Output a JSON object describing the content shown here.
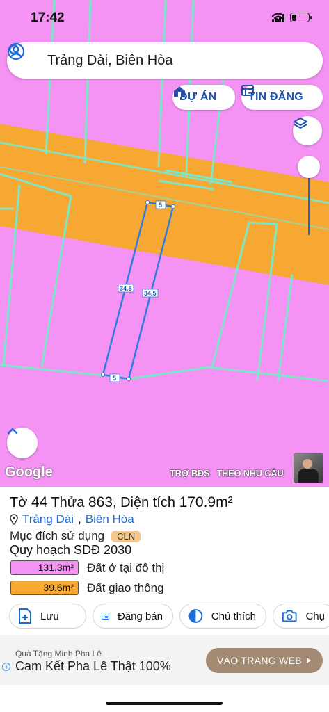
{
  "status_bar": {
    "time": "17:42"
  },
  "search": {
    "query": "Trảng Dài, Biên Hòa"
  },
  "map_buttons": {
    "project_label": "DỰ ÁN",
    "listing_label": "TIN ĐĂNG"
  },
  "map": {
    "parcel_side_top": "5",
    "parcel_side_bottom": "5",
    "parcel_side_left": "34.5",
    "parcel_side_right": "34.5",
    "colors": {
      "residential": "#f593f5",
      "traffic": "#f7a833",
      "parcel_lines": "#7de6c8",
      "highlight": "#2f7be0"
    }
  },
  "attribution": {
    "google": "Google",
    "promo_text_1": "TRỢ BĐS",
    "promo_text_2": "THEO NHU CẦU"
  },
  "parcel": {
    "sheet_label": "Tờ",
    "sheet_no": "44",
    "lot_label": "Thửa",
    "lot_no": "863",
    "area_label": "Diện tích",
    "area_value": "170.9m²",
    "ward": "Trảng Dài",
    "city": "Biên Hòa",
    "usage_label": "Mục đích sử dụng",
    "usage_code": "CLN",
    "plan_title": "Quy hoạch SDĐ 2030",
    "zones": [
      {
        "area": "131.3m²",
        "label": "Đất ở tại đô thị",
        "color": "#f593f5"
      },
      {
        "area": "39.6m²",
        "label": "Đất giao thông",
        "color": "#f7a833"
      }
    ]
  },
  "actions": {
    "save": "Lưu",
    "sell": "Đăng bán",
    "legend": "Chú thích",
    "photo": "Chụ"
  },
  "ad": {
    "advertiser": "Quà Tặng Minh Pha Lê",
    "headline": "Cam Kết Pha Lê Thật 100%",
    "cta": "VÀO TRANG WEB"
  }
}
